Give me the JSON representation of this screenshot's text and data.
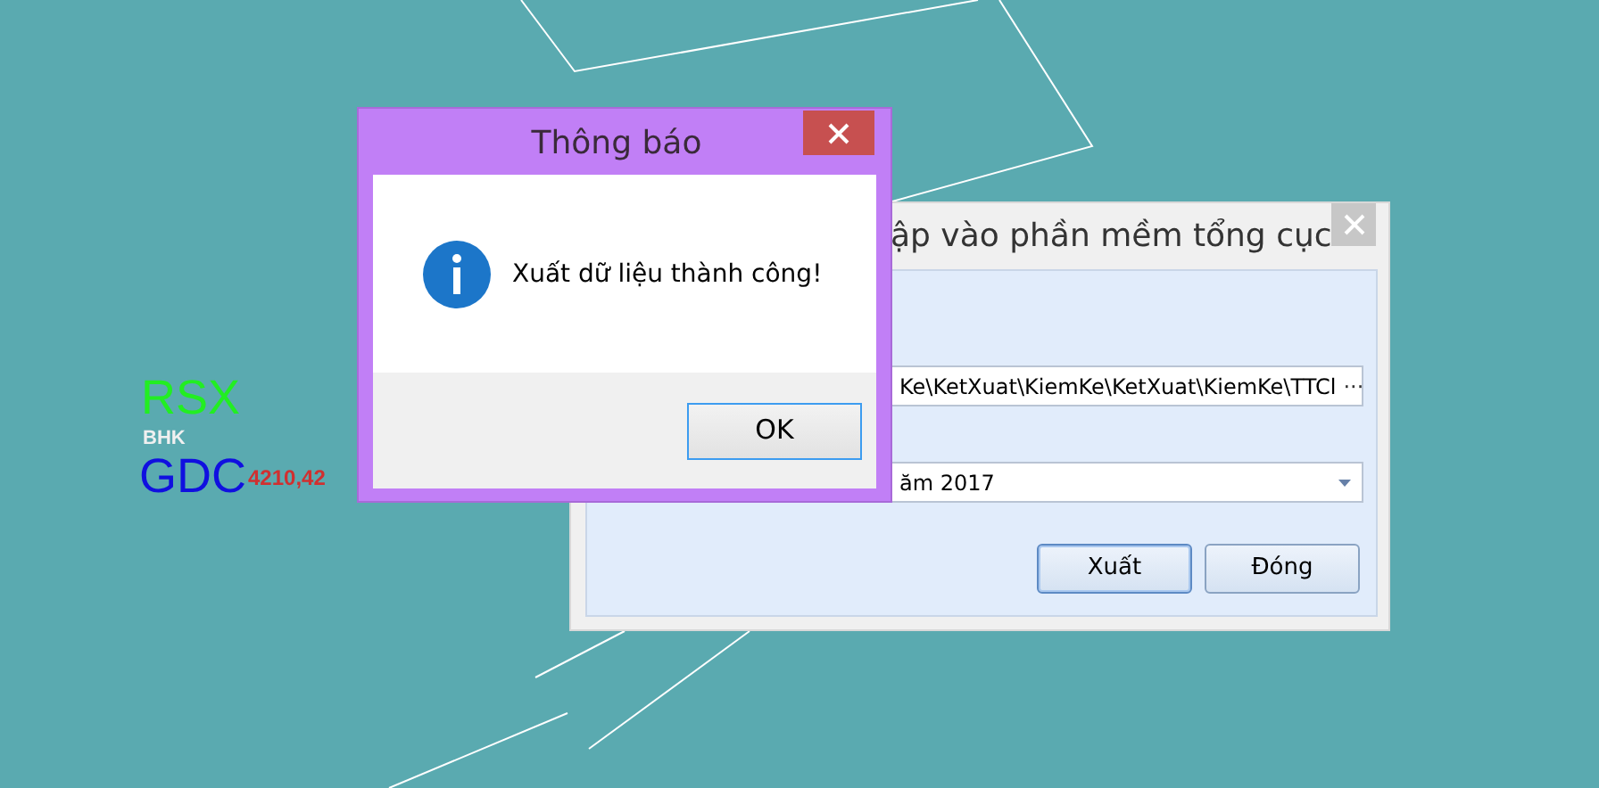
{
  "desktop": {
    "logo_texts": [
      {
        "text": "RSX",
        "kind": "big",
        "color": "#22ee22"
      },
      {
        "text": "BHK",
        "kind": "small",
        "color": "#f0f0f0"
      },
      {
        "text": "GDC",
        "kind": "big",
        "color": "#1010e0"
      },
      {
        "text": "4210,42",
        "kind": "number",
        "color": "#d03030"
      }
    ]
  },
  "background_window": {
    "title": "ập vào phần mềm tổng cục",
    "path_field": {
      "value": "Ke\\KetXuat\\KiemKe\\KetXuat\\KiemKe\\TTCl"
    },
    "browse_button": "···",
    "year_combo": {
      "value": "ăm 2017"
    },
    "buttons": [
      {
        "label": "Xuất",
        "focused": true
      },
      {
        "label": "Đóng",
        "focused": false
      }
    ]
  },
  "message_box": {
    "title": "Thông báo",
    "message": "Xuất dữ liệu thành công!",
    "buttons": [
      {
        "label": "OK",
        "focused": true
      }
    ]
  }
}
